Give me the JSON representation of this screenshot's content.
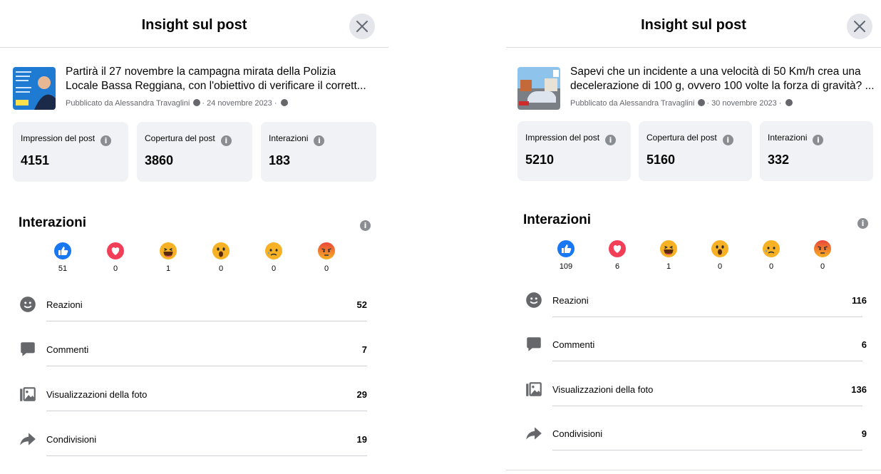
{
  "left": {
    "header_title": "Insight sul post",
    "post_line1": "Partirà il 27 novembre la campagna mirata della Polizia",
    "post_line2": "Locale Bassa Reggiana, con l'obiettivo di verificare il corrett...",
    "post_meta_prefix": "Pubblicato da Alessandra Travaglini",
    "post_meta_date": "· 24 novembre 2023 ·",
    "stats": [
      {
        "label": "Impression del post",
        "value": "4151"
      },
      {
        "label": "Copertura del post",
        "value": "3860"
      },
      {
        "label": "Interazioni",
        "value": "183"
      }
    ],
    "section_title": "Interazioni",
    "reactions": [
      "51",
      "0",
      "1",
      "0",
      "0",
      "0"
    ],
    "rows": [
      {
        "label": "Reazioni",
        "value": "52"
      },
      {
        "label": "Commenti",
        "value": "7"
      },
      {
        "label": "Visualizzazioni della foto",
        "value": "29"
      },
      {
        "label": "Condivisioni",
        "value": "19"
      }
    ]
  },
  "right": {
    "header_title": "Insight sul post",
    "post_line1": "Sapevi che un incidente a una velocità di 50 Km/h crea una",
    "post_line2": "decelerazione di 100 g, ovvero 100 volte la forza di gravità? ...",
    "post_meta_prefix": "Pubblicato da Alessandra Travaglini",
    "post_meta_date": "· 30 novembre 2023 ·",
    "stats": [
      {
        "label": "Impression del post",
        "value": "5210"
      },
      {
        "label": "Copertura del post",
        "value": "5160"
      },
      {
        "label": "Interazioni",
        "value": "332"
      }
    ],
    "section_title": "Interazioni",
    "reactions": [
      "109",
      "6",
      "1",
      "0",
      "0",
      "0"
    ],
    "rows": [
      {
        "label": "Reazioni",
        "value": "116"
      },
      {
        "label": "Commenti",
        "value": "6"
      },
      {
        "label": "Visualizzazioni della foto",
        "value": "136"
      },
      {
        "label": "Condivisioni",
        "value": "9"
      }
    ]
  },
  "reaction_types": [
    "like-icon",
    "love-icon",
    "haha-icon",
    "wow-icon",
    "sad-icon",
    "angry-icon"
  ],
  "colors": {
    "like": "#1877f2",
    "love": "#f33e58",
    "emoji": "#f7b125",
    "text_secondary": "#65676b",
    "card_bg": "#f0f2f5"
  }
}
